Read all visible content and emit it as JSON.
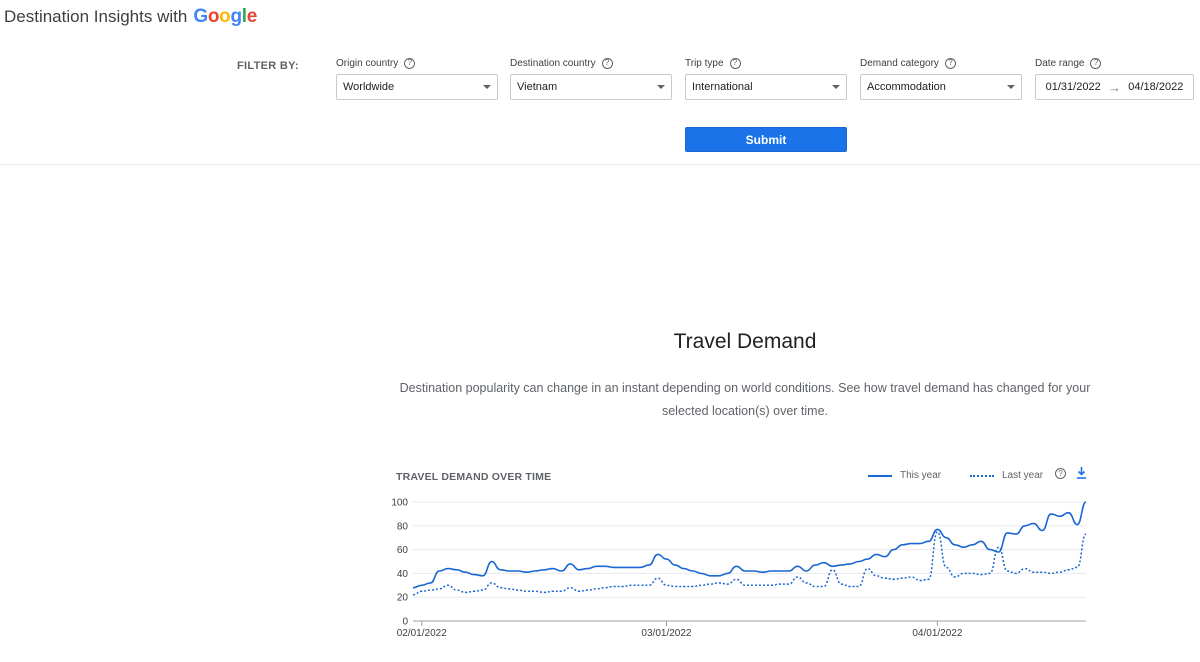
{
  "header": {
    "title_prefix": "Destination Insights with",
    "logo_letters": [
      {
        "ch": "G",
        "color": "#4285f4"
      },
      {
        "ch": "o",
        "color": "#ea4335"
      },
      {
        "ch": "o",
        "color": "#fbbc05"
      },
      {
        "ch": "g",
        "color": "#4285f4"
      },
      {
        "ch": "l",
        "color": "#34a853"
      },
      {
        "ch": "e",
        "color": "#ea4335"
      }
    ]
  },
  "filters": {
    "label": "FILTER BY:",
    "origin": {
      "label": "Origin country",
      "value": "Worldwide"
    },
    "destination": {
      "label": "Destination country",
      "value": "Vietnam"
    },
    "trip_type": {
      "label": "Trip type",
      "value": "International"
    },
    "demand": {
      "label": "Demand category",
      "value": "Accommodation"
    },
    "date_range": {
      "label": "Date range",
      "start": "01/31/2022",
      "end": "04/18/2022"
    },
    "help_glyph": "?",
    "submit_label": "Submit"
  },
  "section": {
    "title": "Travel Demand",
    "description": "Destination popularity can change in an instant depending on world conditions. See how travel demand has changed for your selected location(s) over time."
  },
  "chart_data": {
    "type": "line",
    "title": "TRAVEL DEMAND OVER TIME",
    "xlabel": "",
    "ylabel": "",
    "ylim": [
      0,
      100
    ],
    "yticks": [
      0,
      20,
      40,
      60,
      80,
      100
    ],
    "x_start": "01/31/2022",
    "x_end": "04/18/2022",
    "xtick_labels": [
      "02/01/2022",
      "03/01/2022",
      "04/01/2022"
    ],
    "xtick_dates": [
      "2022-02-01",
      "2022-03-01",
      "2022-04-01"
    ],
    "grid": true,
    "legend_position": "top-right",
    "series": [
      {
        "name": "This year",
        "style": "solid",
        "color": "#1967d2",
        "points": [
          [
            "2022-01-31",
            28
          ],
          [
            "2022-02-01",
            30
          ],
          [
            "2022-02-02",
            32
          ],
          [
            "2022-02-03",
            42
          ],
          [
            "2022-02-04",
            44
          ],
          [
            "2022-02-05",
            43
          ],
          [
            "2022-02-06",
            41
          ],
          [
            "2022-02-07",
            39
          ],
          [
            "2022-02-08",
            38
          ],
          [
            "2022-02-09",
            50
          ],
          [
            "2022-02-10",
            43
          ],
          [
            "2022-02-11",
            42
          ],
          [
            "2022-02-12",
            42
          ],
          [
            "2022-02-13",
            41
          ],
          [
            "2022-02-14",
            42
          ],
          [
            "2022-02-15",
            43
          ],
          [
            "2022-02-16",
            44
          ],
          [
            "2022-02-17",
            42
          ],
          [
            "2022-02-18",
            48
          ],
          [
            "2022-02-19",
            43
          ],
          [
            "2022-02-20",
            44
          ],
          [
            "2022-02-21",
            46
          ],
          [
            "2022-02-22",
            46
          ],
          [
            "2022-02-23",
            45
          ],
          [
            "2022-02-24",
            45
          ],
          [
            "2022-02-25",
            45
          ],
          [
            "2022-02-26",
            45
          ],
          [
            "2022-02-27",
            47
          ],
          [
            "2022-02-28",
            56
          ],
          [
            "2022-03-01",
            52
          ],
          [
            "2022-03-02",
            47
          ],
          [
            "2022-03-03",
            44
          ],
          [
            "2022-03-04",
            42
          ],
          [
            "2022-03-05",
            40
          ],
          [
            "2022-03-06",
            38
          ],
          [
            "2022-03-07",
            38
          ],
          [
            "2022-03-08",
            40
          ],
          [
            "2022-03-09",
            46
          ],
          [
            "2022-03-10",
            42
          ],
          [
            "2022-03-11",
            42
          ],
          [
            "2022-03-12",
            41
          ],
          [
            "2022-03-13",
            42
          ],
          [
            "2022-03-14",
            42
          ],
          [
            "2022-03-15",
            42
          ],
          [
            "2022-03-16",
            46
          ],
          [
            "2022-03-17",
            42
          ],
          [
            "2022-03-18",
            47
          ],
          [
            "2022-03-19",
            49
          ],
          [
            "2022-03-20",
            46
          ],
          [
            "2022-03-21",
            47
          ],
          [
            "2022-03-22",
            48
          ],
          [
            "2022-03-23",
            50
          ],
          [
            "2022-03-24",
            52
          ],
          [
            "2022-03-25",
            56
          ],
          [
            "2022-03-26",
            54
          ],
          [
            "2022-03-27",
            60
          ],
          [
            "2022-03-28",
            64
          ],
          [
            "2022-03-29",
            65
          ],
          [
            "2022-03-30",
            65
          ],
          [
            "2022-03-31",
            67
          ],
          [
            "2022-04-01",
            77
          ],
          [
            "2022-04-02",
            70
          ],
          [
            "2022-04-03",
            64
          ],
          [
            "2022-04-04",
            62
          ],
          [
            "2022-04-05",
            64
          ],
          [
            "2022-04-06",
            67
          ],
          [
            "2022-04-07",
            60
          ],
          [
            "2022-04-08",
            58
          ],
          [
            "2022-04-09",
            74
          ],
          [
            "2022-04-10",
            73
          ],
          [
            "2022-04-11",
            80
          ],
          [
            "2022-04-12",
            82
          ],
          [
            "2022-04-13",
            76
          ],
          [
            "2022-04-14",
            90
          ],
          [
            "2022-04-15",
            88
          ],
          [
            "2022-04-16",
            91
          ],
          [
            "2022-04-17",
            81
          ],
          [
            "2022-04-18",
            100
          ]
        ]
      },
      {
        "name": "Last year",
        "style": "dotted",
        "color": "#1967d2",
        "points": [
          [
            "2022-01-31",
            22
          ],
          [
            "2022-02-01",
            25
          ],
          [
            "2022-02-02",
            26
          ],
          [
            "2022-02-03",
            27
          ],
          [
            "2022-02-04",
            30
          ],
          [
            "2022-02-05",
            26
          ],
          [
            "2022-02-06",
            24
          ],
          [
            "2022-02-07",
            25
          ],
          [
            "2022-02-08",
            26
          ],
          [
            "2022-02-09",
            32
          ],
          [
            "2022-02-10",
            28
          ],
          [
            "2022-02-11",
            27
          ],
          [
            "2022-02-12",
            26
          ],
          [
            "2022-02-13",
            25
          ],
          [
            "2022-02-14",
            25
          ],
          [
            "2022-02-15",
            24
          ],
          [
            "2022-02-16",
            25
          ],
          [
            "2022-02-17",
            25
          ],
          [
            "2022-02-18",
            28
          ],
          [
            "2022-02-19",
            25
          ],
          [
            "2022-02-20",
            26
          ],
          [
            "2022-02-21",
            27
          ],
          [
            "2022-02-22",
            28
          ],
          [
            "2022-02-23",
            29
          ],
          [
            "2022-02-24",
            29
          ],
          [
            "2022-02-25",
            30
          ],
          [
            "2022-02-26",
            30
          ],
          [
            "2022-02-27",
            30
          ],
          [
            "2022-02-28",
            36
          ],
          [
            "2022-03-01",
            30
          ],
          [
            "2022-03-02",
            29
          ],
          [
            "2022-03-03",
            29
          ],
          [
            "2022-03-04",
            29
          ],
          [
            "2022-03-05",
            30
          ],
          [
            "2022-03-06",
            31
          ],
          [
            "2022-03-07",
            32
          ],
          [
            "2022-03-08",
            31
          ],
          [
            "2022-03-09",
            35
          ],
          [
            "2022-03-10",
            30
          ],
          [
            "2022-03-11",
            30
          ],
          [
            "2022-03-12",
            30
          ],
          [
            "2022-03-13",
            30
          ],
          [
            "2022-03-14",
            31
          ],
          [
            "2022-03-15",
            31
          ],
          [
            "2022-03-16",
            37
          ],
          [
            "2022-03-17",
            32
          ],
          [
            "2022-03-18",
            29
          ],
          [
            "2022-03-19",
            29
          ],
          [
            "2022-03-20",
            43
          ],
          [
            "2022-03-21",
            31
          ],
          [
            "2022-03-22",
            29
          ],
          [
            "2022-03-23",
            29
          ],
          [
            "2022-03-24",
            44
          ],
          [
            "2022-03-25",
            38
          ],
          [
            "2022-03-26",
            36
          ],
          [
            "2022-03-27",
            35
          ],
          [
            "2022-03-28",
            36
          ],
          [
            "2022-03-29",
            37
          ],
          [
            "2022-03-30",
            34
          ],
          [
            "2022-03-31",
            35
          ],
          [
            "2022-04-01",
            75
          ],
          [
            "2022-04-02",
            45
          ],
          [
            "2022-04-03",
            37
          ],
          [
            "2022-04-04",
            40
          ],
          [
            "2022-04-05",
            40
          ],
          [
            "2022-04-06",
            39
          ],
          [
            "2022-04-07",
            40
          ],
          [
            "2022-04-08",
            62
          ],
          [
            "2022-04-09",
            42
          ],
          [
            "2022-04-10",
            40
          ],
          [
            "2022-04-11",
            44
          ],
          [
            "2022-04-12",
            41
          ],
          [
            "2022-04-13",
            41
          ],
          [
            "2022-04-14",
            40
          ],
          [
            "2022-04-15",
            41
          ],
          [
            "2022-04-16",
            43
          ],
          [
            "2022-04-17",
            45
          ],
          [
            "2022-04-18",
            73
          ]
        ]
      }
    ]
  },
  "icons": {
    "help": "help-circle-icon",
    "download": "download-icon",
    "caret": "caret-down-icon",
    "arrow": "arrow-right-icon"
  }
}
